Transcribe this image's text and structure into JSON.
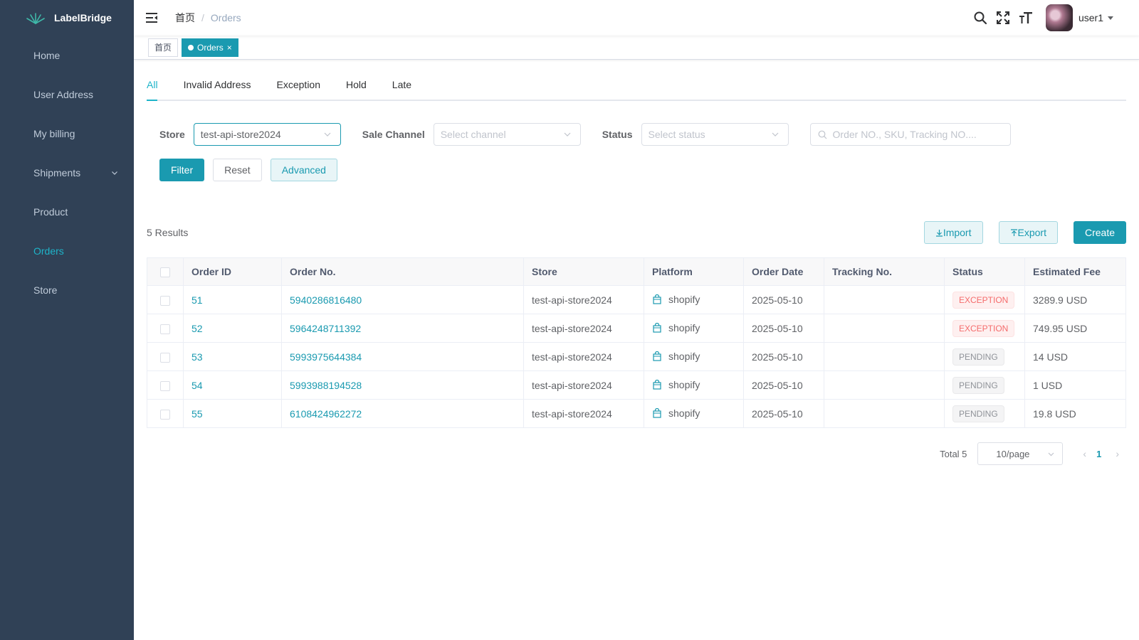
{
  "app": {
    "name": "LabelBridge"
  },
  "sidebar": {
    "items": [
      {
        "label": "Home"
      },
      {
        "label": "User Address"
      },
      {
        "label": "My billing"
      },
      {
        "label": "Shipments"
      },
      {
        "label": "Product"
      },
      {
        "label": "Orders",
        "active": true
      },
      {
        "label": "Store"
      }
    ]
  },
  "header": {
    "breadcrumb_home": "首页",
    "breadcrumb_sep": "/",
    "breadcrumb_current": "Orders",
    "username": "user1"
  },
  "tags": {
    "home": "首页",
    "current": "Orders",
    "close": "×"
  },
  "tabs": [
    "All",
    "Invalid Address",
    "Exception",
    "Hold",
    "Late"
  ],
  "filters": {
    "store_label": "Store",
    "store_value": "test-api-store2024",
    "channel_label": "Sale Channel",
    "channel_placeholder": "Select channel",
    "status_label": "Status",
    "status_placeholder": "Select status",
    "search_placeholder": "Order NO., SKU, Tracking NO...."
  },
  "buttons": {
    "filter": "Filter",
    "reset": "Reset",
    "advanced": "Advanced",
    "import": "Import",
    "export": "Export",
    "create": "Create"
  },
  "results_text": "5 Results",
  "table": {
    "headers": [
      "Order ID",
      "Order No.",
      "Store",
      "Platform",
      "Order Date",
      "Tracking No.",
      "Status",
      "Estimated Fee"
    ],
    "rows": [
      {
        "id": "51",
        "no": "5940286816480",
        "store": "test-api-store2024",
        "platform": "shopify",
        "date": "2025-05-10",
        "tracking": "",
        "status": "EXCEPTION",
        "fee": "3289.9 USD"
      },
      {
        "id": "52",
        "no": "5964248711392",
        "store": "test-api-store2024",
        "platform": "shopify",
        "date": "2025-05-10",
        "tracking": "",
        "status": "EXCEPTION",
        "fee": "749.95 USD"
      },
      {
        "id": "53",
        "no": "5993975644384",
        "store": "test-api-store2024",
        "platform": "shopify",
        "date": "2025-05-10",
        "tracking": "",
        "status": "PENDING",
        "fee": "14 USD"
      },
      {
        "id": "54",
        "no": "5993988194528",
        "store": "test-api-store2024",
        "platform": "shopify",
        "date": "2025-05-10",
        "tracking": "",
        "status": "PENDING",
        "fee": "1 USD"
      },
      {
        "id": "55",
        "no": "6108424962272",
        "store": "test-api-store2024",
        "platform": "shopify",
        "date": "2025-05-10",
        "tracking": "",
        "status": "PENDING",
        "fee": "19.8 USD"
      }
    ]
  },
  "pagination": {
    "total": "Total 5",
    "page_size": "10/page",
    "current": "1"
  },
  "colors": {
    "sidebar_bg": "#304156",
    "accent": "#1a9ab0",
    "exception": "#f56c6c",
    "pending": "#909399"
  }
}
